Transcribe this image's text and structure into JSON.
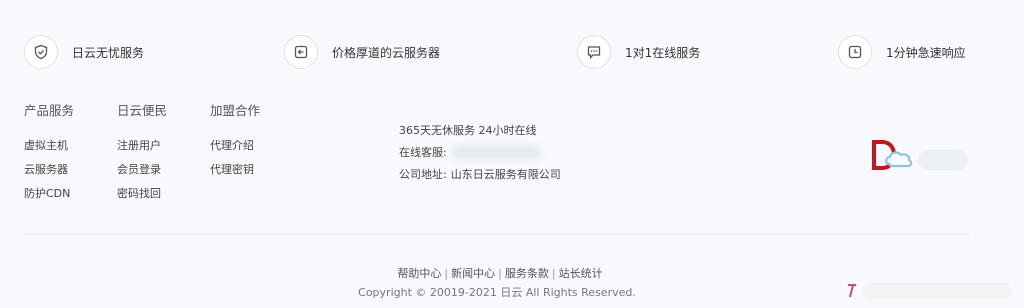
{
  "features": [
    {
      "icon": "shield-check-icon",
      "label": "日云无忧服务"
    },
    {
      "icon": "return-arrow-icon",
      "label": "价格厚道的云服务器"
    },
    {
      "icon": "chat-bubble-icon",
      "label": "1对1在线服务"
    },
    {
      "icon": "clock-icon",
      "label": "1分钟急速响应"
    }
  ],
  "columns": [
    {
      "title": "产品服务",
      "links": [
        "虚拟主机",
        "云服务器",
        "防护CDN"
      ]
    },
    {
      "title": "日云便民",
      "links": [
        "注册用户",
        "会员登录",
        "密码找回"
      ]
    },
    {
      "title": "加盟合作",
      "links": [
        "代理介绍",
        "代理密钥"
      ]
    }
  ],
  "contact": {
    "service": "365天无休服务 24小时在线",
    "support_label": "在线客服:",
    "address_label": "公司地址:",
    "address_value": "山东日云服务有限公司"
  },
  "bottom_links": [
    "帮助中心",
    "新闻中心",
    "服务条款",
    "站长统计"
  ],
  "separator": "|",
  "copyright": "Copyright © 20019-2021 日云 All Rights Reserved.",
  "colors": {
    "logo_red": "#c8161d",
    "logo_blue": "#8fc3e6",
    "icon_stroke": "#555555"
  }
}
